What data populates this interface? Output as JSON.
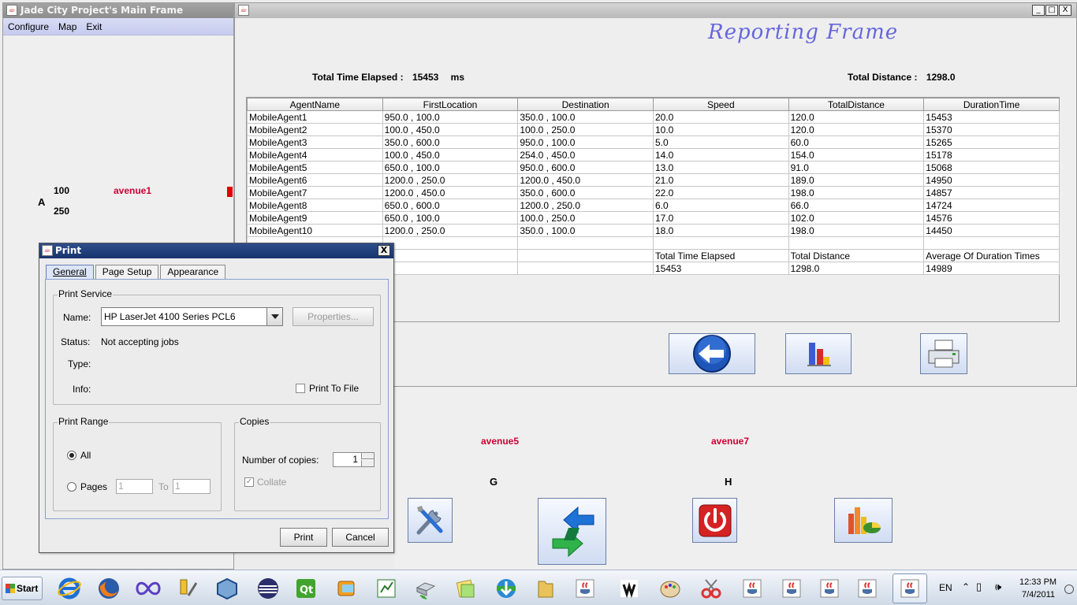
{
  "main_frame": {
    "title": "Jade City Project's Main Frame",
    "menu": [
      "Configure",
      "Map",
      "Exit"
    ],
    "map": {
      "row_label": "A",
      "value_top": "100",
      "value_bottom": "250",
      "avenue_label": "avenue1"
    }
  },
  "report_frame": {
    "heading": "Reporting Frame",
    "total_time_label": "Total Time Elapsed :",
    "total_time_value": "15453",
    "total_time_unit": "ms",
    "total_distance_label": "Total Distance :",
    "total_distance_value": "1298.0",
    "columns": [
      "AgentName",
      "FirstLocation",
      "Destination",
      "Speed",
      "TotalDistance",
      "DurationTime"
    ],
    "rows": [
      [
        "MobileAgent1",
        "950.0 , 100.0",
        "350.0 , 100.0",
        "20.0",
        "120.0",
        "15453"
      ],
      [
        "MobileAgent2",
        "100.0 , 450.0",
        "100.0 , 250.0",
        "10.0",
        "120.0",
        "15370"
      ],
      [
        "MobileAgent3",
        "350.0 , 600.0",
        "950.0 , 100.0",
        "5.0",
        "60.0",
        "15265"
      ],
      [
        "MobileAgent4",
        "100.0 , 450.0",
        "254.0 , 450.0",
        "14.0",
        "154.0",
        "15178"
      ],
      [
        "MobileAgent5",
        "650.0 , 100.0",
        "950.0 , 600.0",
        "13.0",
        "91.0",
        "15068"
      ],
      [
        "MobileAgent6",
        "1200.0 , 250.0",
        "1200.0 , 450.0",
        "21.0",
        "189.0",
        "14950"
      ],
      [
        "MobileAgent7",
        "1200.0 , 450.0",
        "350.0 , 600.0",
        "22.0",
        "198.0",
        "14857"
      ],
      [
        "MobileAgent8",
        "650.0 , 600.0",
        "1200.0 , 250.0",
        "6.0",
        "66.0",
        "14724"
      ],
      [
        "MobileAgent9",
        "650.0 , 100.0",
        "100.0 , 250.0",
        "17.0",
        "102.0",
        "14576"
      ],
      [
        "MobileAgent10",
        "1200.0 , 250.0",
        "350.0 , 100.0",
        "18.0",
        "198.0",
        "14450"
      ],
      [
        "",
        "",
        "",
        "",
        "",
        ""
      ],
      [
        "",
        "",
        "",
        "Total Time Elapsed",
        "Total Distance",
        "Average Of Duration Times"
      ],
      [
        "",
        "",
        "",
        "15453",
        "1298.0",
        "14989"
      ]
    ],
    "window_buttons": [
      "_",
      "□",
      "X"
    ]
  },
  "print_dialog": {
    "title": "Print",
    "close_glyph": "X",
    "tabs": [
      "General",
      "Page Setup",
      "Appearance"
    ],
    "print_service": {
      "group_title": "Print Service",
      "name_label": "Name:",
      "name_value": "HP LaserJet 4100 Series PCL6",
      "properties_button": "Properties...",
      "status_label": "Status:",
      "status_value": "Not accepting jobs",
      "type_label": "Type:",
      "info_label": "Info:",
      "print_to_file_label": "Print To File"
    },
    "print_range": {
      "group_title": "Print Range",
      "all_label": "All",
      "pages_label": "Pages",
      "from_value": "1",
      "to_label": "To",
      "to_value": "1"
    },
    "copies": {
      "group_title": "Copies",
      "number_label": "Number of copies:",
      "number_value": "1",
      "collate_label": "Collate"
    },
    "print_button": "Print",
    "cancel_button": "Cancel"
  },
  "bottom_area": {
    "avenue5": "avenue5",
    "avenue7": "avenue7",
    "label_g": "G",
    "label_h": "H"
  },
  "taskbar": {
    "start_label": "Start",
    "language": "EN",
    "time": "12:33 PM",
    "date": "7/4/2011"
  }
}
